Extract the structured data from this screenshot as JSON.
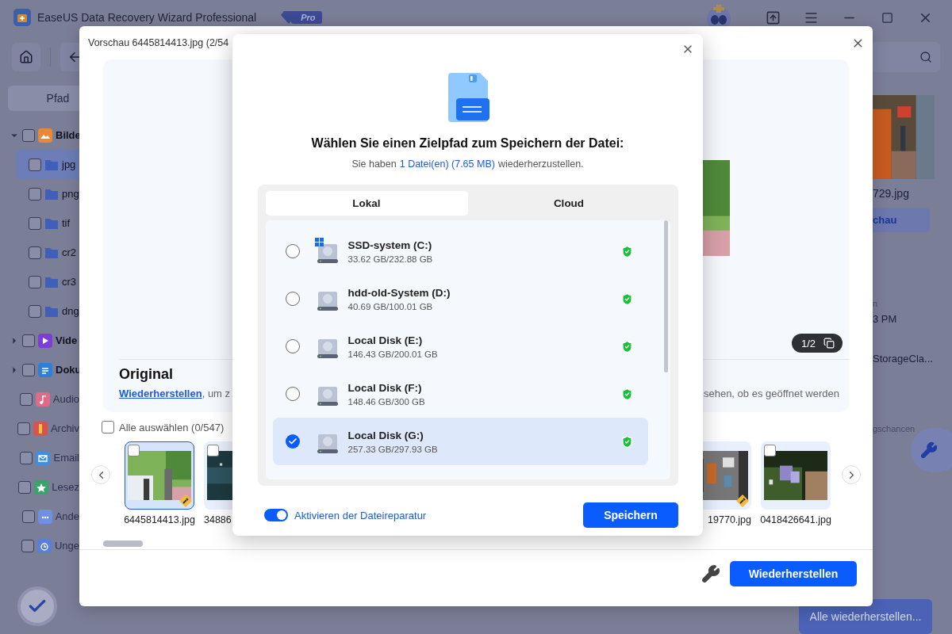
{
  "app": {
    "title": "EaseUS Data Recovery Wizard Professional",
    "edition_badge": "Pro"
  },
  "sidebar": {
    "tab": "Pfad",
    "tree": [
      {
        "label": "Bilde",
        "expanded": true,
        "checked": false,
        "disabled": false,
        "color": "#e8893a",
        "children": [
          {
            "label": "jpg",
            "selected": true,
            "checked": false
          },
          {
            "label": "png",
            "selected": false,
            "checked": false
          },
          {
            "label": "tif",
            "selected": false,
            "checked": false
          },
          {
            "label": "cr2",
            "selected": false,
            "checked": false
          },
          {
            "label": "cr3",
            "selected": false,
            "checked": false
          },
          {
            "label": "dng",
            "selected": false,
            "checked": false
          }
        ]
      },
      {
        "label": "Vide",
        "expanded": false,
        "checked": false,
        "disabled": false,
        "color": "#7b3fd6"
      },
      {
        "label": "Doku",
        "expanded": false,
        "checked": false,
        "disabled": false,
        "color": "#2e7fd8"
      },
      {
        "label": "Audio",
        "checked": false,
        "disabled": true,
        "color": "#e06a88"
      },
      {
        "label": "Archiv",
        "checked": false,
        "disabled": true,
        "color": "#d9534f"
      },
      {
        "label": "Email",
        "checked": false,
        "disabled": true,
        "color": "#3d8fe0"
      },
      {
        "label": "Lesez",
        "checked": false,
        "disabled": true,
        "color": "#3aa36a"
      },
      {
        "label": "Ande",
        "checked": false,
        "disabled": true,
        "color": "#6f8fe0"
      },
      {
        "label": "Unge",
        "checked": false,
        "disabled": true,
        "color": "#5a7fd8"
      }
    ]
  },
  "details_panel": {
    "thumbnail_caption": "729.jpg",
    "preview_button": "chau",
    "info_lines": [
      "n",
      "3 PM",
      "StorageCla..."
    ],
    "hint": "gschancen"
  },
  "bottom_bar": {
    "recover_all_button": "Alle wiederherstellen..."
  },
  "preview": {
    "title": "Vorschau 6445814413.jpg (2/54",
    "page_counter": "1/2",
    "section_title": "Original",
    "recover_link": "Wiederherstellen",
    "hint_start": ", um z",
    "hint_end": "sehen, ob es geöffnet werden",
    "select_all": {
      "label": "Alle auswählen (0/547)",
      "checked": false
    },
    "thumbnails": [
      {
        "name": "6445814413.jpg",
        "selected": true,
        "checked": false,
        "repaired": true
      },
      {
        "name": "34886",
        "selected": false,
        "checked": false
      },
      {
        "name": "19770.jpg",
        "selected": false,
        "repaired": true
      },
      {
        "name": "0418426641.jpg",
        "selected": false,
        "checked": false,
        "repaired": false
      }
    ],
    "recover_button": "Wiederherstellen"
  },
  "save_dialog": {
    "title": "Wählen Sie einen Zielpfad zum Speichern der Datei:",
    "subtitle_before": "Sie haben",
    "subtitle_count": "1 Datei(en) (7.65 MB)",
    "subtitle_after": "wiederherzustellen.",
    "tabs": [
      {
        "label": "Lokal",
        "selected": true
      },
      {
        "label": "Cloud",
        "selected": false
      }
    ],
    "drives": [
      {
        "name": "SSD-system (C:)",
        "size": "33.62 GB/232.88 GB",
        "kind": "system",
        "selected": false
      },
      {
        "name": "hdd-old-System (D:)",
        "size": "40.69 GB/100.01 GB",
        "kind": "disk",
        "selected": false
      },
      {
        "name": "Local Disk (E:)",
        "size": "146.43 GB/200.01 GB",
        "kind": "disk",
        "selected": false
      },
      {
        "name": "Local Disk (F:)",
        "size": "148.46 GB/300 GB",
        "kind": "disk",
        "selected": false
      },
      {
        "name": "Local Disk (G:)",
        "size": "257.33 GB/297.93 GB",
        "kind": "disk",
        "selected": true
      }
    ],
    "repair_toggle": {
      "label": "Aktivieren der Dateireparatur",
      "on": true
    },
    "save_button": "Speichern"
  }
}
